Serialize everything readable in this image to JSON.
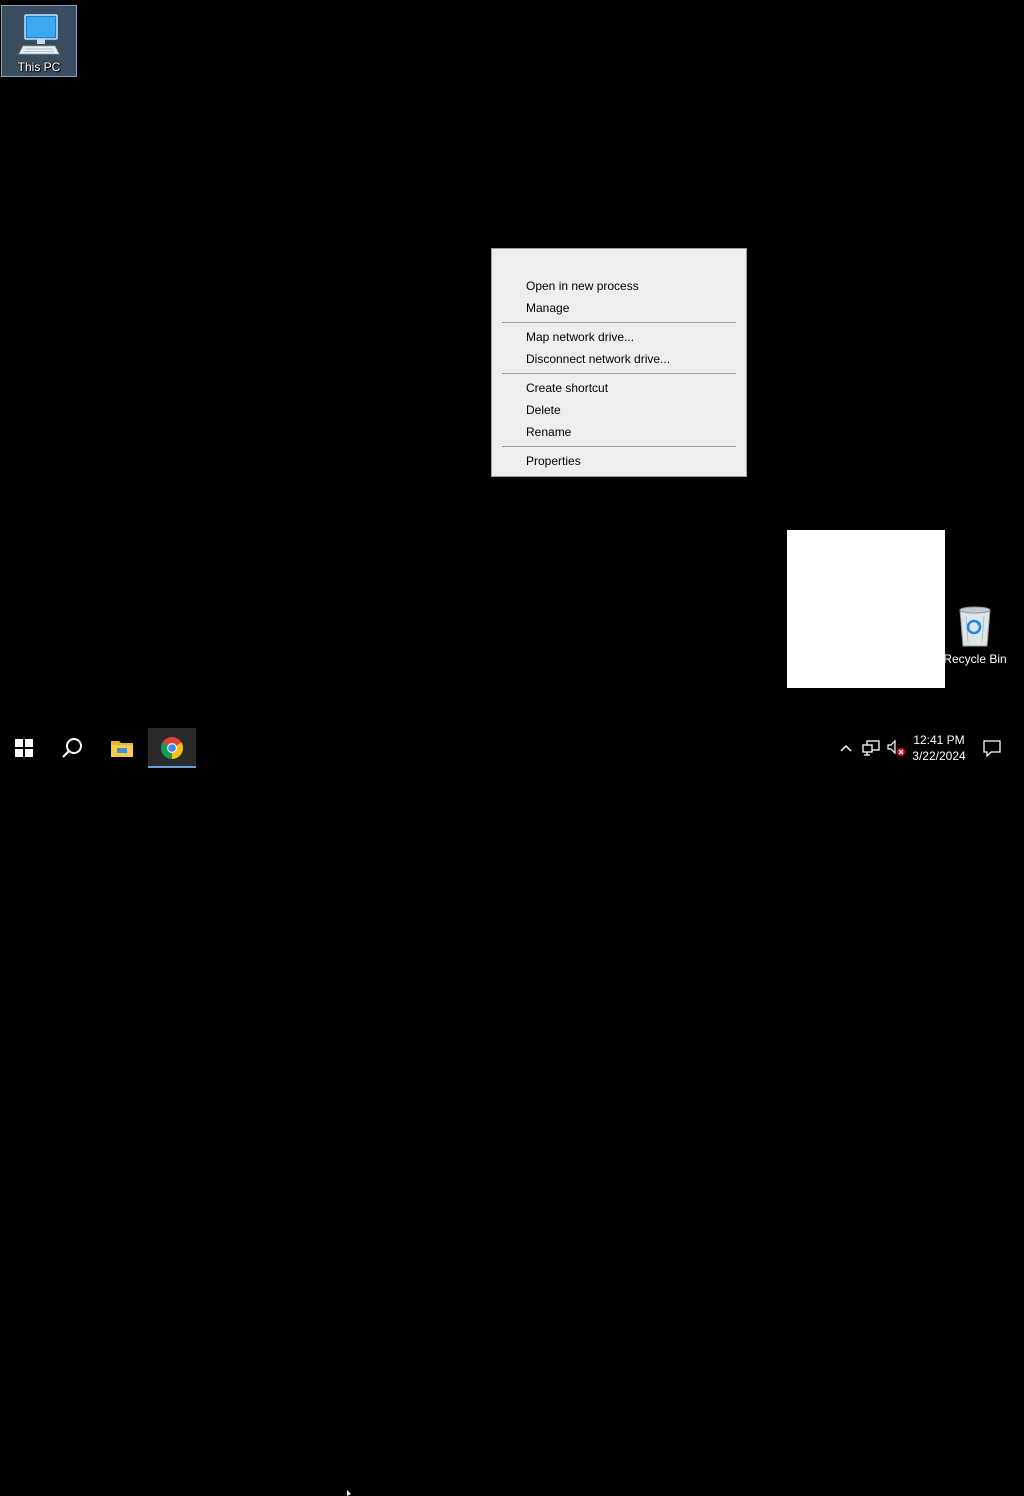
{
  "desktop": {
    "icons": [
      {
        "label": "This PC",
        "icon": "this-pc-icon",
        "selected": true
      },
      {
        "label": "Recycle Bin",
        "icon": "recycle-bin-icon",
        "selected": false
      }
    ]
  },
  "context_menu": {
    "groups": [
      [
        "Open in new process",
        "Manage"
      ],
      [
        "Map network drive...",
        "Disconnect network drive..."
      ],
      [
        "Create shortcut",
        "Delete",
        "Rename"
      ],
      [
        "Properties"
      ]
    ],
    "items": {
      "open_new_process": "Open in new process",
      "manage": "Manage",
      "map_network_drive": "Map network drive...",
      "disconnect_network_drive": "Disconnect network drive...",
      "create_shortcut": "Create shortcut",
      "delete": "Delete",
      "rename": "Rename",
      "properties": "Properties"
    }
  },
  "taskbar": {
    "buttons": [
      "windows-start-icon",
      "search-icon",
      "file-explorer-icon",
      "chrome-icon"
    ],
    "active": "chrome-icon",
    "tray": [
      "chevron-up-icon",
      "network-icon",
      "volume-muted-icon"
    ],
    "clock": {
      "time": "12:41 PM",
      "date": "3/22/2024"
    },
    "notification_icon": "action-center-icon"
  },
  "colors": {
    "desktop_bg": "#000000",
    "menu_bg": "#eeeeee",
    "selection": "#80aad2",
    "taskbar_active_underline": "#6a9fd8"
  }
}
